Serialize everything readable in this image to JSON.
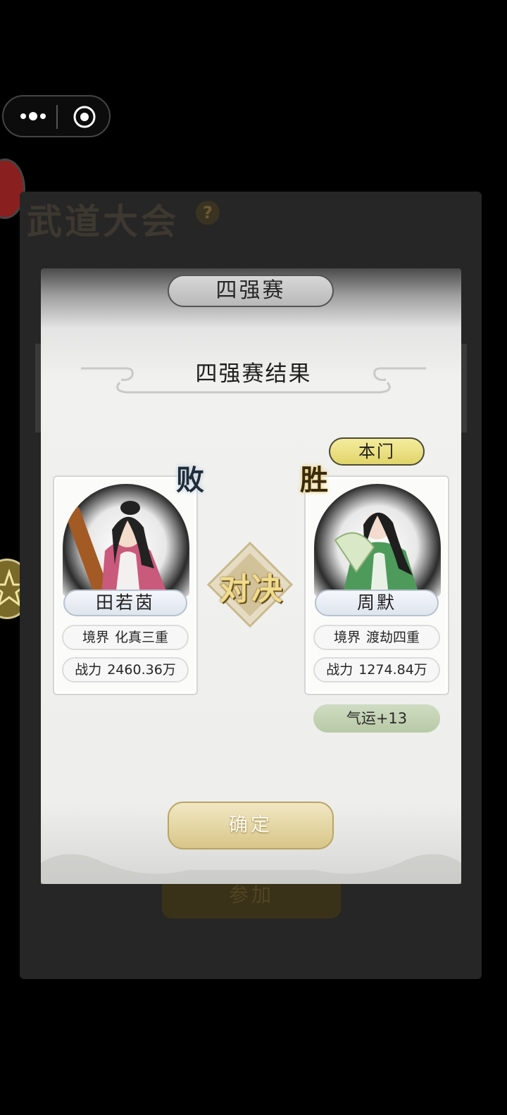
{
  "miniapp": {
    "menu_icon": "more-dots-icon",
    "close_icon": "target-icon"
  },
  "background": {
    "title": "武道大会",
    "help_glyph": "?",
    "join_label": "参加"
  },
  "modal": {
    "header": "四强赛",
    "result_title": "四强赛结果",
    "vs_label": "对决",
    "confirm_label": "确定",
    "left": {
      "result_badge": "败",
      "name": "田若茵",
      "realm_label": "境界",
      "realm_value": "化真三重",
      "power_label": "战力",
      "power_value": "2460.36万"
    },
    "right": {
      "tag": "本门",
      "result_badge": "胜",
      "name": "周默",
      "realm_label": "境界",
      "realm_value": "渡劫四重",
      "power_label": "战力",
      "power_value": "1274.84万",
      "reward": "气运+13"
    }
  },
  "colors": {
    "win_gold": "#e2d46a",
    "luck_green": "#b8c9a6",
    "confirm_gold": "#d8c688"
  }
}
